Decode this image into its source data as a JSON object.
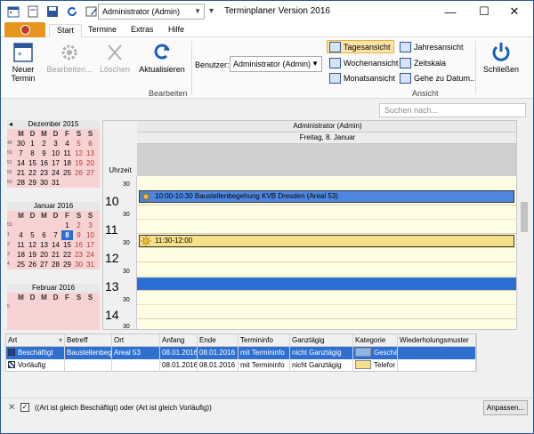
{
  "title_bar": {
    "user_combo": "Administrator (Admin)",
    "app_title": "Terminplaner Version 2016"
  },
  "ribbon_tabs": [
    "Start",
    "Termine",
    "Extras",
    "Hilfe"
  ],
  "ribbon": {
    "new_appt": [
      "Neuer",
      "Termin"
    ],
    "edit": "Bearbeiten...",
    "delete": "Löschen",
    "refresh": "Aktualisieren",
    "group_edit": "Bearbeiten",
    "user_label": "Benutzer:",
    "user_value": "Administrator (Admin)",
    "views_col1": [
      "Tagesansicht",
      "Wochenansicht",
      "Monatsansicht"
    ],
    "views_col2": [
      "Jahresansicht",
      "Zeitskala",
      "Gehe zu Datum..."
    ],
    "selected_view": "Tagesansicht",
    "group_view": "Ansicht",
    "close": "Schließen"
  },
  "search": {
    "placeholder": "Suchen nach..."
  },
  "mini_calendars": [
    {
      "title": "Dezember 2015",
      "weekdays": [
        "M",
        "D",
        "M",
        "D",
        "F",
        "S",
        "S"
      ],
      "weeks": [
        {
          "wk": "49",
          "days": [
            "30",
            "1",
            "2",
            "3",
            "4",
            "5",
            "6"
          ]
        },
        {
          "wk": "50",
          "days": [
            "7",
            "8",
            "9",
            "10",
            "11",
            "12",
            "13"
          ]
        },
        {
          "wk": "51",
          "days": [
            "14",
            "15",
            "16",
            "17",
            "18",
            "19",
            "20"
          ]
        },
        {
          "wk": "52",
          "days": [
            "21",
            "22",
            "23",
            "24",
            "25",
            "26",
            "27"
          ]
        },
        {
          "wk": "53",
          "days": [
            "28",
            "29",
            "30",
            "31",
            "",
            "",
            ""
          ]
        }
      ]
    },
    {
      "title": "Januar 2016",
      "weekdays": [
        "M",
        "D",
        "M",
        "D",
        "F",
        "S",
        "S"
      ],
      "weeks": [
        {
          "wk": "53",
          "days": [
            "",
            "",
            "",
            "",
            "1",
            "2",
            "3"
          ]
        },
        {
          "wk": "1",
          "days": [
            "4",
            "5",
            "6",
            "7",
            "8",
            "9",
            "10"
          ]
        },
        {
          "wk": "2",
          "days": [
            "11",
            "12",
            "13",
            "14",
            "15",
            "16",
            "17"
          ]
        },
        {
          "wk": "3",
          "days": [
            "18",
            "19",
            "20",
            "21",
            "22",
            "23",
            "24"
          ]
        },
        {
          "wk": "4",
          "days": [
            "25",
            "26",
            "27",
            "28",
            "29",
            "30",
            "31"
          ]
        }
      ],
      "today": "8"
    },
    {
      "title": "Februar 2016",
      "weekdays": [
        "M",
        "D",
        "M",
        "D",
        "F",
        "S",
        "S"
      ],
      "weeks": [
        {
          "wk": "5",
          "days": [
            "",
            "",
            "",
            "",
            "",
            "",
            ""
          ]
        }
      ]
    }
  ],
  "day_view": {
    "owner": "Administrator (Admin)",
    "date": "Freitag, 8. Januar",
    "uhrzeit": "Uhrzeit",
    "hours": [
      "10",
      "11",
      "12",
      "13",
      "14"
    ],
    "half_label": "30",
    "appointments": [
      {
        "text": "10:00-10:30 Baustellenbegehung KVB Dresden (Areal 53)",
        "status": "busy"
      },
      {
        "text": "11:30-12:00",
        "status": "tentative"
      }
    ]
  },
  "grid": {
    "headers": [
      "Art",
      "Betreff",
      "Ort",
      "Anfang",
      "Ende",
      "Termininfo",
      "Ganztägig",
      "Kategorie",
      "Wiederholungsmuster"
    ],
    "rows": [
      [
        "Beschäftigt",
        "Baustellenbeg",
        "Areal 53",
        "08.01.2016",
        "08.01.2016",
        "mit Termininfo",
        "nicht Ganztägig",
        "Geschä",
        ""
      ],
      [
        "Vorläufig",
        "",
        "",
        "08.01.2016",
        "08.01.2016",
        "mit Termininfo",
        "nicht Ganztägig",
        "Telefor",
        ""
      ]
    ]
  },
  "filter": {
    "text": "((Art ist gleich Beschäftigt) oder (Art ist gleich Vorläufig))",
    "customize": "Anpassen..."
  },
  "colors": {
    "busy": "#2c6fd4",
    "tentative": "#f7e08a",
    "file_tab": "#e6961f",
    "selected_view": "#fce4a8"
  }
}
